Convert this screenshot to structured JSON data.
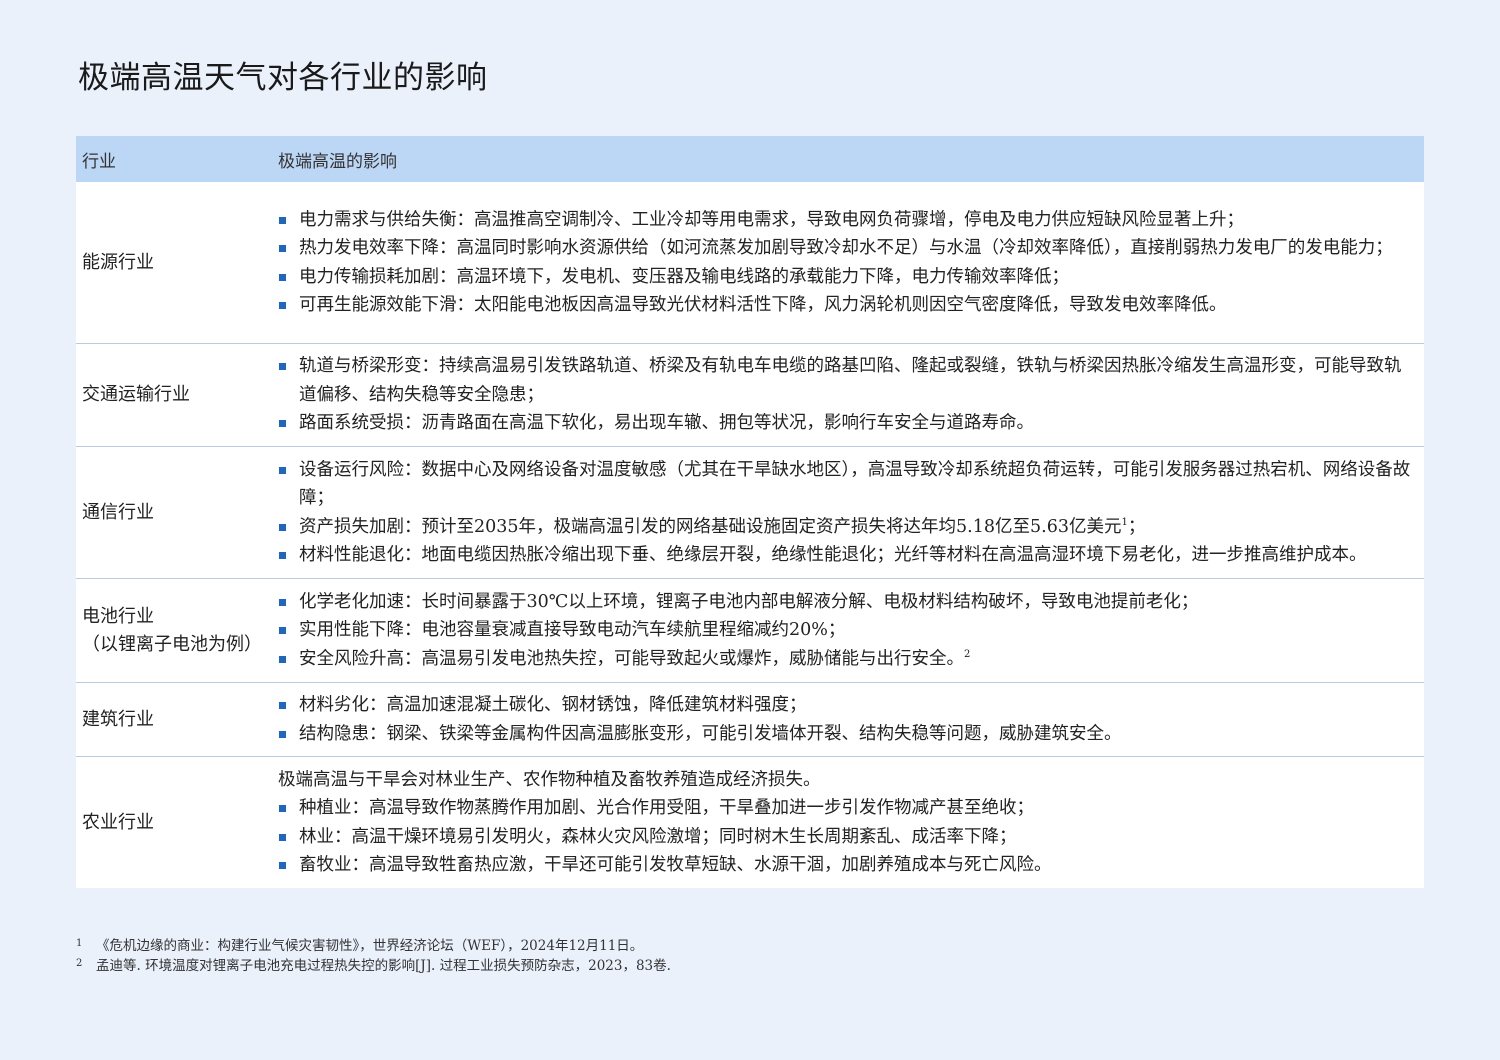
{
  "title": "极端高温天气对各行业的影响",
  "table": {
    "headers": {
      "industry": "行业",
      "impact": "极端高温的影响"
    },
    "rows": [
      {
        "industry": "能源行业",
        "industry_sub": "",
        "intro": "",
        "bullets": [
          "电力需求与供给失衡：高温推高空调制冷、工业冷却等用电需求，导致电网负荷骤增，停电及电力供应短缺风险显著上升；",
          "热力发电效率下降：高温同时影响水资源供给（如河流蒸发加剧导致冷却水不足）与水温（冷却效率降低），直接削弱热力发电厂的发电能力；",
          "电力传输损耗加剧：高温环境下，发电机、变压器及输电线路的承载能力下降，电力传输效率降低；",
          "可再生能源效能下滑：太阳能电池板因高温导致光伏材料活性下降，风力涡轮机则因空气密度降低，导致发电效率降低。"
        ],
        "sups": [
          "",
          "",
          "",
          ""
        ]
      },
      {
        "industry": "交通运输行业",
        "industry_sub": "",
        "intro": "",
        "bullets": [
          "轨道与桥梁形变：持续高温易引发铁路轨道、桥梁及有轨电车电缆的路基凹陷、隆起或裂缝，铁轨与桥梁因热胀冷缩发生高温形变，可能导致轨道偏移、结构失稳等安全隐患；",
          "路面系统受损：沥青路面在高温下软化，易出现车辙、拥包等状况，影响行车安全与道路寿命。"
        ],
        "sups": [
          "",
          ""
        ]
      },
      {
        "industry": "通信行业",
        "industry_sub": "",
        "intro": "",
        "bullets": [
          "设备运行风险：数据中心及网络设备对温度敏感（尤其在干旱缺水地区），高温导致冷却系统超负荷运转，可能引发服务器过热宕机、网络设备故障；",
          "资产损失加剧：预计至2035年，极端高温引发的网络基础设施固定资产损失将达年均5.18亿至5.63亿美元",
          "材料性能退化：地面电缆因热胀冷缩出现下垂、绝缘层开裂，绝缘性能退化；光纤等材料在高温高湿环境下易老化，进一步推高维护成本。"
        ],
        "sups": [
          "",
          "1",
          ""
        ],
        "after_sup": [
          "",
          "；",
          ""
        ]
      },
      {
        "industry": "电池行业",
        "industry_sub": "（以锂离子电池为例）",
        "intro": "",
        "bullets": [
          "化学老化加速：长时间暴露于30℃以上环境，锂离子电池内部电解液分解、电极材料结构破坏，导致电池提前老化；",
          "实用性能下降：电池容量衰减直接导致电动汽车续航里程缩减约20%；",
          "安全风险升高：高温易引发电池热失控，可能导致起火或爆炸，威胁储能与出行安全。"
        ],
        "sups": [
          "",
          "",
          "2"
        ],
        "after_sup": [
          "",
          "",
          ""
        ]
      },
      {
        "industry": "建筑行业",
        "industry_sub": "",
        "intro": "",
        "bullets": [
          "材料劣化：高温加速混凝土碳化、钢材锈蚀，降低建筑材料强度；",
          "结构隐患：钢梁、铁梁等金属构件因高温膨胀变形，可能引发墙体开裂、结构失稳等问题，威胁建筑安全。"
        ],
        "sups": [
          "",
          ""
        ]
      },
      {
        "industry": "农业行业",
        "industry_sub": "",
        "intro": "极端高温与干旱会对林业生产、农作物种植及畜牧养殖造成经济损失。",
        "bullets": [
          "种植业：高温导致作物蒸腾作用加剧、光合作用受阻，干旱叠加进一步引发作物减产甚至绝收；",
          "林业：高温干燥环境易引发明火，森林火灾风险激增；同时树木生长周期紊乱、成活率下降；",
          "畜牧业：高温导致牲畜热应激，干旱还可能引发牧草短缺、水源干涸，加剧养殖成本与死亡风险。"
        ],
        "sups": [
          "",
          "",
          ""
        ]
      }
    ]
  },
  "footnotes": [
    {
      "num": "1",
      "text": "《危机边缘的商业：构建行业气候灾害韧性》，世界经济论坛（WEF），2024年12月11日。"
    },
    {
      "num": "2",
      "text": "孟迪等.  环境温度对锂离子电池充电过程热失控的影响[J].  过程工业损失预防杂志，2023，83卷."
    }
  ],
  "colors": {
    "background": "#eaf1fb",
    "header_bg": "#bcd6f5",
    "bullet": "#1f66c2",
    "row_border": "#b9cbe0"
  }
}
